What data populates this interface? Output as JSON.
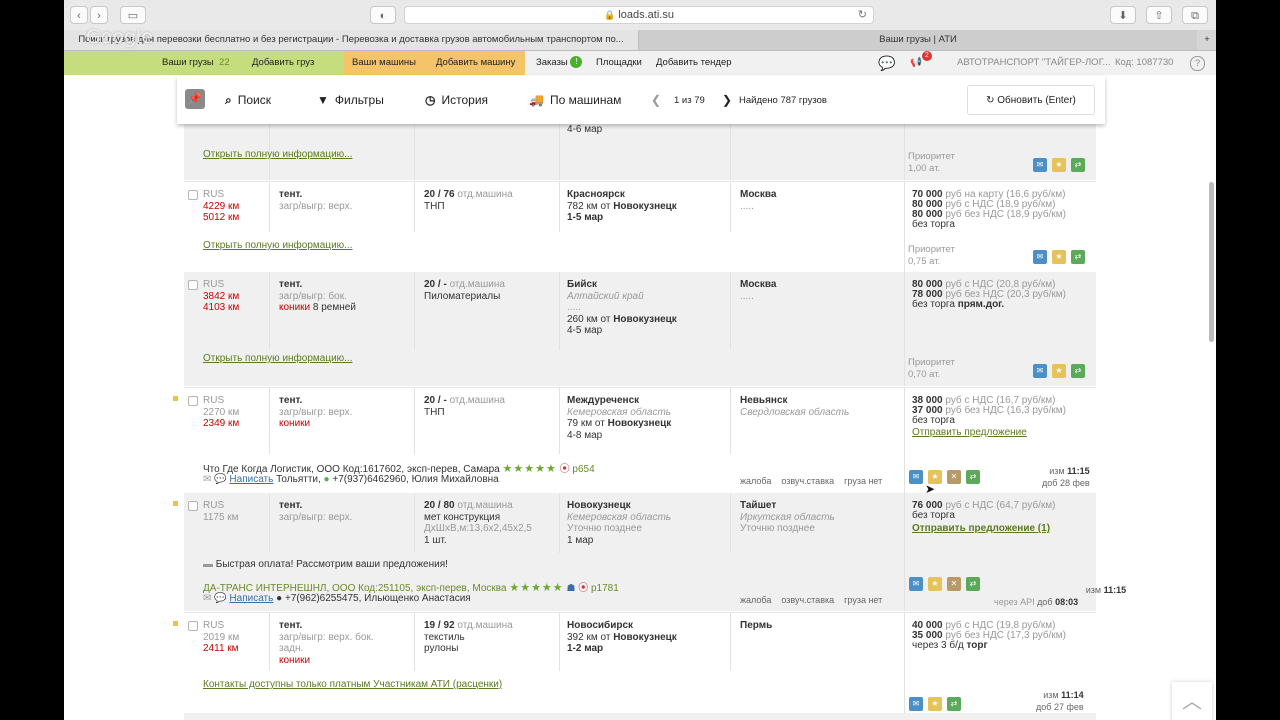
{
  "browser": {
    "url": "loads.ati.su",
    "tab1_title": "Поиск грузов для перевозки бесплатно и без регистрации - Перевозка и доставка грузов автомобильным транспортом по...",
    "tab2_title": "Ваши грузы | АТИ",
    "watermark": "Google"
  },
  "nav": {
    "your_cargo": "Ваши грузы",
    "your_cargo_count": "22",
    "add_cargo": "Добавить груз",
    "your_cars": "Ваши машины",
    "add_car": "Добавить машину",
    "orders": "Заказы",
    "orders_badge": "!",
    "platforms": "Площадки",
    "add_tender": "Добавить тендер",
    "notif_count": "2",
    "company": "АВТОТРАНСПОРТ \"ТАЙГЕР-ЛОГ...",
    "code": "Код: 1087730",
    "help": "?"
  },
  "searchbar": {
    "search": "Поиск",
    "filters": "Фильтры",
    "history": "История",
    "by_cars": "По машинам",
    "page": "1 из 79",
    "found": "Найдено 787 грузов",
    "refresh": "Обновить (Enter)"
  },
  "common": {
    "open_full": "Открыть полную информацию...",
    "priority": "Приоритет",
    "write": "Написать",
    "complaint": "жалоба",
    "voice_rate": "озвуч.ставка",
    "no_cargo": "груза нет",
    "changed": "изм",
    "added": "доб"
  },
  "row0": {
    "dates": "4-6 мар",
    "priority_value": "1,00 ат."
  },
  "row1": {
    "country": "RUS",
    "km1": "4229 км",
    "km2": "5012 км",
    "body": "тент.",
    "load": "загр/выгр: верх.",
    "weight": "20 / 76",
    "weight_suffix": "отд.машина",
    "cargo": "ТНП",
    "from": "Красноярск",
    "dist": "782 км от",
    "dist_city": "Новокузнецк",
    "dates": "1-5 мар",
    "to": "Москва",
    "to_sub": ".....",
    "p1": "70 000",
    "p1s": "руб на карту",
    "p1r": "(16,6 руб/км)",
    "p2": "80 000",
    "p2s": "руб с НДС",
    "p2r": "(18,9 руб/км)",
    "p3": "80 000",
    "p3s": "руб без НДС",
    "p3r": "(18,9 руб/км)",
    "p4": "без торга",
    "priority_value": "0,75 ат."
  },
  "row2": {
    "country": "RUS",
    "km1": "3842 км",
    "km2": "4103 км",
    "body": "тент.",
    "load": "загр/выгр: бок.",
    "extra_red": "коники",
    "extra": "8 ремней",
    "weight": "20 / -",
    "weight_suffix": "отд.машина",
    "cargo": "Пиломатериалы",
    "from": "Бийск",
    "from_region": "Алтайский край",
    "from_sub": ".....",
    "dist": "260 км от",
    "dist_city": "Новокузнецк",
    "dates": "4-5 мар",
    "to": "Москва",
    "to_sub": ".....",
    "p1": "80 000",
    "p1s": "руб с НДС",
    "p1r": "(20,8 руб/км)",
    "p2": "78 000",
    "p2s": "руб без НДС",
    "p2r": "(20,3 руб/км)",
    "p3": "без торга",
    "p3b": "прям.дог.",
    "priority_value": "0,70 ат."
  },
  "row3": {
    "country": "RUS",
    "km1": "2270 км",
    "km2": "2349 км",
    "body": "тент.",
    "load": "загр/выгр: верх.",
    "extra_red": "коники",
    "weight": "20 / -",
    "weight_suffix": "отд.машина",
    "cargo": "ТНП",
    "from": "Междуреченск",
    "from_region": "Кемеровская область",
    "dist": "79 км от",
    "dist_city": "Новокузнецк",
    "dates": "4-8 мар",
    "to": "Невьянск",
    "to_region": "Свердловская область",
    "p1": "38 000",
    "p1s": "руб с НДС",
    "p1r": "(16,7 руб/км)",
    "p2": "37 000",
    "p2s": "руб без НДС",
    "p2r": "(16,3 руб/км)",
    "p3": "без торга",
    "offer": "Отправить предложение",
    "company": "Что Где Когда Логистик, ООО Код:1617602, эксп-перев, Самара",
    "rating": "★★★★★",
    "score": "р654",
    "city": "Тольятти,",
    "phone": "+7(937)6462960, Юлия Михайловна",
    "changed_time": "11:15",
    "added_date": "28 фев"
  },
  "row4": {
    "country": "RUS",
    "km1": "1175 км",
    "body": "тент.",
    "load": "загр/выгр: верх.",
    "weight": "20 / 80",
    "weight_suffix": "отд.машина",
    "cargo": "мет конструкция",
    "dims": "ДхШхВ,м:13,6x2,45x2,5",
    "qty": "1 шт.",
    "from": "Новокузнецк",
    "from_region": "Кемеровская область",
    "from_sub": "Уточню позднее",
    "dates": "1 мар",
    "to": "Тайшет",
    "to_region": "Иркутская область",
    "to_sub": "Уточню позднее",
    "p1": "76 000",
    "p1s": "руб с НДС",
    "p1r": "(64,7 руб/км)",
    "p2": "без торга",
    "offer": "Отправить предложение (1)",
    "note": "Быстрая оплата! Рассмотрим ваши предложения!",
    "company": "ДА-ТРАНС ИНТЕРНЕШНЛ, ООО Код:251105, эксп-перев, Москва",
    "rating": "★★★★★",
    "score": "р1781",
    "phone": "+7(962)6255475, Ильющенко Анастасия",
    "changed_time": "11:15",
    "via_api": "через API",
    "added_time": "08:03"
  },
  "row5": {
    "country": "RUS",
    "km1": "2019 км",
    "km2": "2411 км",
    "body": "тент.",
    "load": "загр/выгр: верх. бок.",
    "load2": "задн.",
    "extra_red": "коники",
    "weight": "19 / 92",
    "weight_suffix": "отд.машина",
    "cargo": "текстиль",
    "cargo2": "рулоны",
    "from": "Новосибирск",
    "dist": "392 км от",
    "dist_city": "Новокузнецк",
    "dates": "1-2 мар",
    "to": "Пермь",
    "p1": "40 000",
    "p1s": "руб с НДС",
    "p1r": "(19,8 руб/км)",
    "p2": "35 000",
    "p2s": "руб без НДС",
    "p2r": "(17,3 руб/км)",
    "p3": "через 3 б/д",
    "p3b": "торг",
    "contacts": "Контакты доступны только платным Участникам АТИ (расценки)",
    "changed_time": "11:14",
    "added_date": "27 фев"
  }
}
